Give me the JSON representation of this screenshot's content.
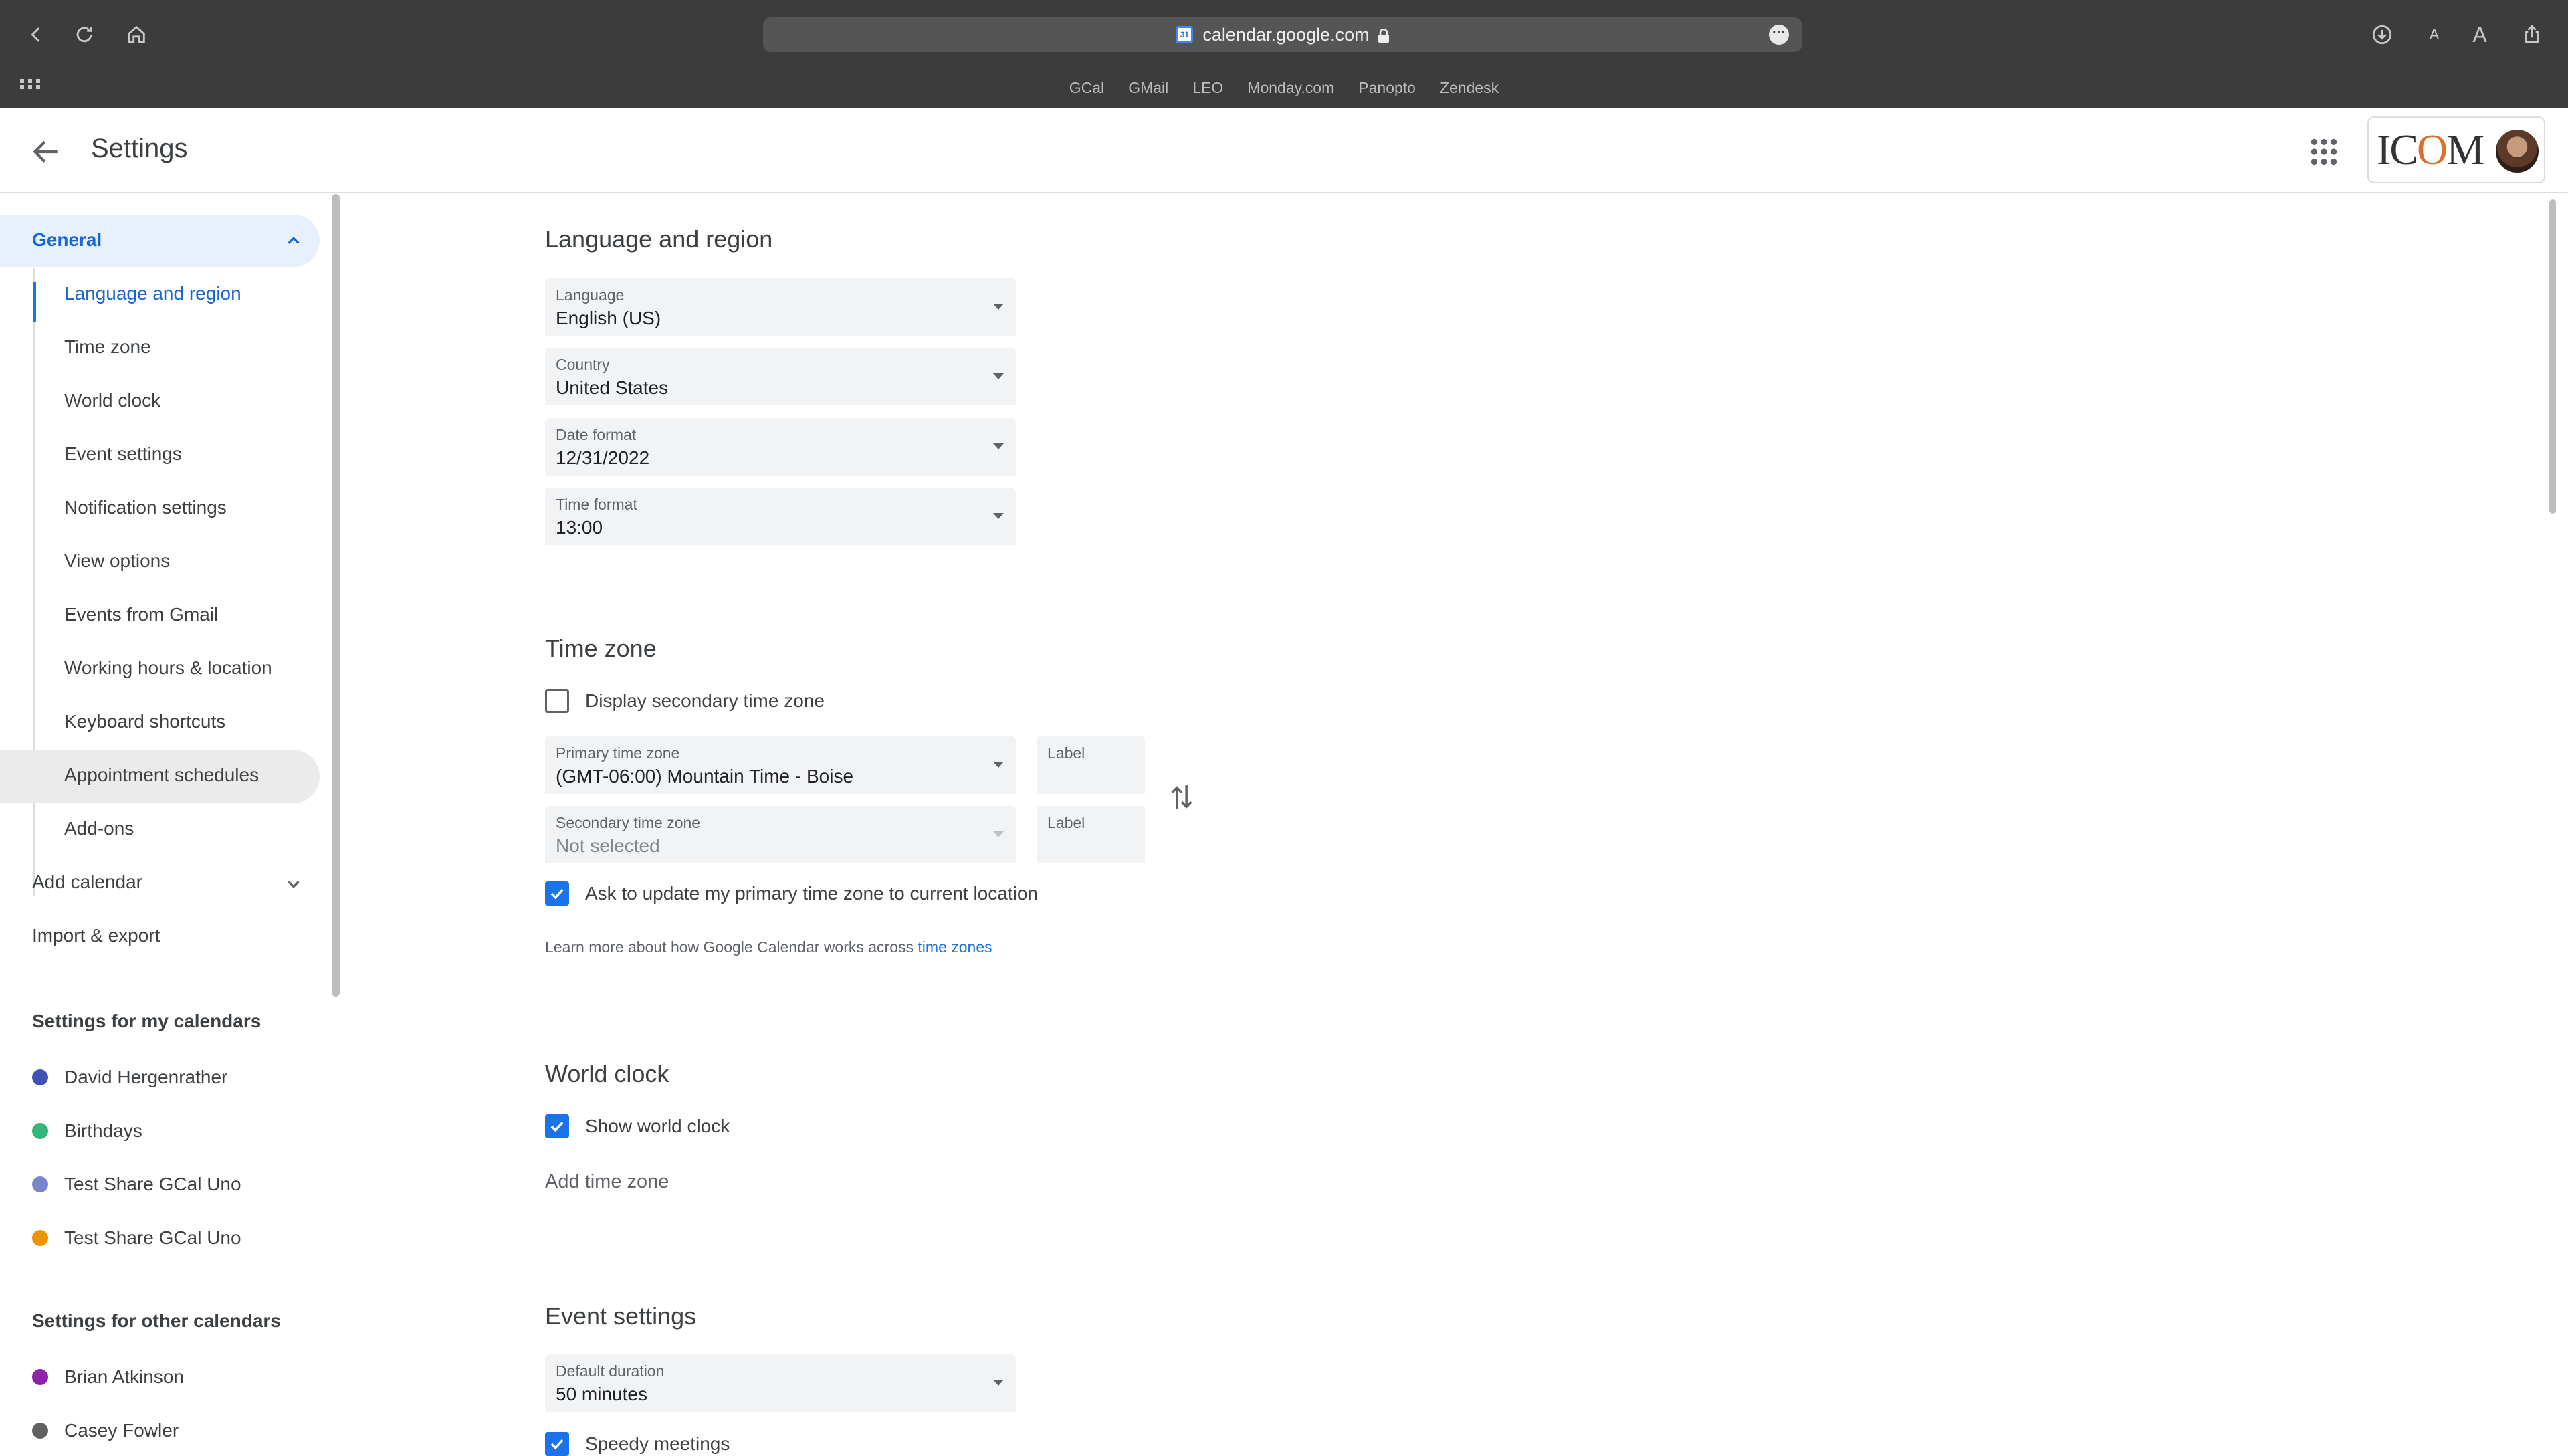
{
  "browser": {
    "url": "calendar.google.com",
    "bookmarks": [
      "GCal",
      "GMail",
      "LEO",
      "Monday.com",
      "Panopto",
      "Zendesk"
    ],
    "icons": [
      "back-icon",
      "reload-icon",
      "home-icon",
      "site-menu-icon",
      "download-icon",
      "text-smaller-icon",
      "text-larger-icon",
      "share-icon",
      "bookmarks-grid-icon"
    ],
    "small_a": "A",
    "large_a": "A",
    "more": "···"
  },
  "header": {
    "title": "Settings",
    "logo_text_prefix": "IC",
    "logo_text_o": "O",
    "logo_text_suffix": "M"
  },
  "sidebar": {
    "general": "General",
    "general_items": [
      "Language and region",
      "Time zone",
      "World clock",
      "Event settings",
      "Notification settings",
      "View options",
      "Events from Gmail",
      "Working hours & location",
      "Keyboard shortcuts",
      "Appointment schedules",
      "Add-ons"
    ],
    "add_calendar": "Add calendar",
    "import_export": "Import & export",
    "my_calendars_heading": "Settings for my calendars",
    "my_calendars": [
      {
        "name": "David Hergenrather",
        "color": "#3f51b5"
      },
      {
        "name": "Birthdays",
        "color": "#33b679"
      },
      {
        "name": "Test Share GCal Uno",
        "color": "#7986cb"
      },
      {
        "name": "Test Share GCal Uno",
        "color": "#f09300"
      }
    ],
    "other_calendars_heading": "Settings for other calendars",
    "other_calendars": [
      {
        "name": "Brian Atkinson",
        "color": "#8e24aa"
      },
      {
        "name": "Casey Fowler",
        "color": "#616161"
      }
    ]
  },
  "language_region": {
    "title": "Language and region",
    "language": {
      "label": "Language",
      "value": "English (US)"
    },
    "country": {
      "label": "Country",
      "value": "United States"
    },
    "date_format": {
      "label": "Date format",
      "value": "12/31/2022"
    },
    "time_format": {
      "label": "Time format",
      "value": "13:00"
    }
  },
  "time_zone": {
    "title": "Time zone",
    "display_secondary": "Display secondary time zone",
    "primary": {
      "label": "Primary time zone",
      "value": "(GMT-06:00) Mountain Time - Boise"
    },
    "secondary": {
      "label": "Secondary time zone",
      "value": "Not selected"
    },
    "label_field": "Label",
    "ask_update": "Ask to update my primary time zone to current location",
    "learn_more": "Learn more about how Google Calendar works across ",
    "learn_link": "time zones"
  },
  "world_clock": {
    "title": "World clock",
    "show": "Show world clock",
    "add": "Add time zone"
  },
  "event_settings": {
    "title": "Event settings",
    "default_duration": {
      "label": "Default duration",
      "value": "50 minutes"
    },
    "speedy": "Speedy meetings"
  },
  "colors": {
    "accent": "#1a73e8",
    "active_bg": "#e8f0fe",
    "chrome": "#3c3c3c"
  }
}
